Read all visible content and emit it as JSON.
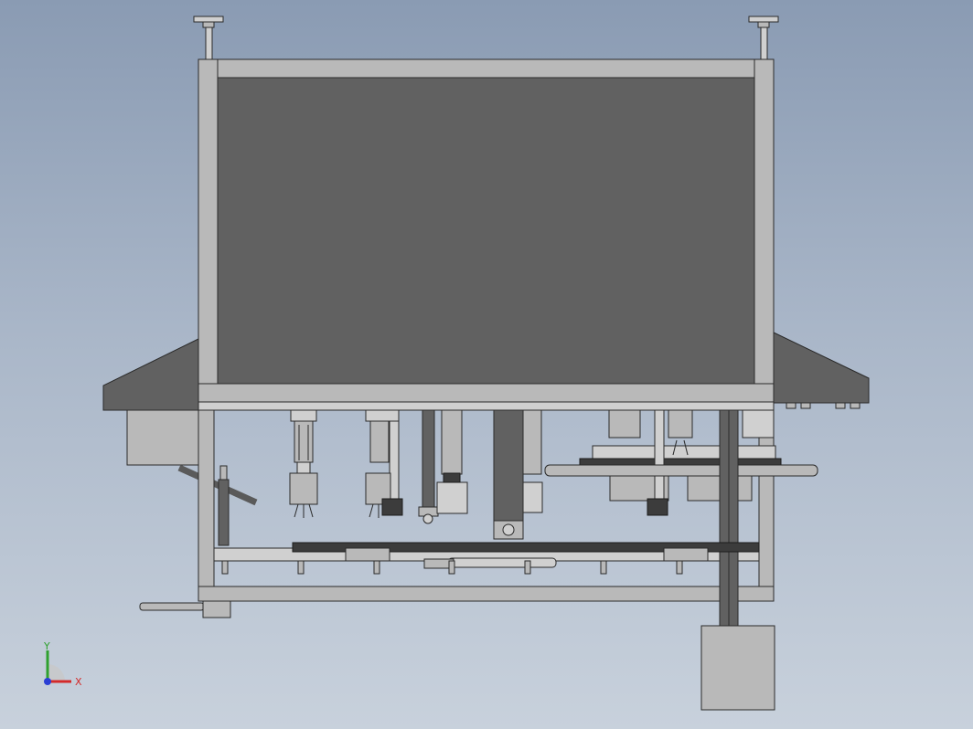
{
  "viewport": {
    "background_top": "#8a9bb3",
    "background_bottom": "#c8d1dc"
  },
  "model": {
    "frame_color": "#b9b9b9",
    "panel_color": "#616161"
  },
  "triad": {
    "y_label": "Y",
    "x_label": "X",
    "y_color": "#2fa12f",
    "x_color": "#d42a2a",
    "z_color": "#2a3fd4"
  }
}
